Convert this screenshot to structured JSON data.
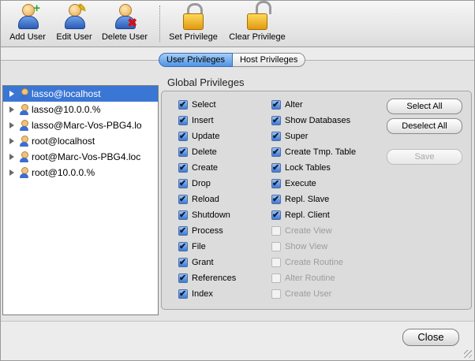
{
  "toolbar": {
    "buttons": [
      {
        "label": "Add User",
        "icon": "user-add-icon"
      },
      {
        "label": "Edit User",
        "icon": "user-edit-icon"
      },
      {
        "label": "Delete User",
        "icon": "user-delete-icon"
      },
      {
        "label": "Set Privilege",
        "icon": "lock-closed-icon"
      },
      {
        "label": "Clear Privilege",
        "icon": "lock-open-icon"
      }
    ]
  },
  "tabs": [
    {
      "label": "User Privileges",
      "active": true
    },
    {
      "label": "Host Privileges",
      "active": false
    }
  ],
  "user_list": [
    {
      "label": "lasso@localhost",
      "selected": true
    },
    {
      "label": "lasso@10.0.0.%",
      "selected": false
    },
    {
      "label": "lasso@Marc-Vos-PBG4.lo",
      "selected": false
    },
    {
      "label": "root@localhost",
      "selected": false
    },
    {
      "label": "root@Marc-Vos-PBG4.loc",
      "selected": false
    },
    {
      "label": "root@10.0.0.%",
      "selected": false
    }
  ],
  "global_privileges": {
    "title": "Global Privileges",
    "left": [
      {
        "label": "Select",
        "checked": true
      },
      {
        "label": "Insert",
        "checked": true
      },
      {
        "label": "Update",
        "checked": true
      },
      {
        "label": "Delete",
        "checked": true
      },
      {
        "label": "Create",
        "checked": true
      },
      {
        "label": "Drop",
        "checked": true
      },
      {
        "label": "Reload",
        "checked": true
      },
      {
        "label": "Shutdown",
        "checked": true
      },
      {
        "label": "Process",
        "checked": true
      },
      {
        "label": "File",
        "checked": true
      },
      {
        "label": "Grant",
        "checked": true
      },
      {
        "label": "References",
        "checked": true
      },
      {
        "label": "Index",
        "checked": true
      }
    ],
    "right": [
      {
        "label": "Alter",
        "checked": true,
        "enabled": true
      },
      {
        "label": "Show Databases",
        "checked": true,
        "enabled": true
      },
      {
        "label": "Super",
        "checked": true,
        "enabled": true
      },
      {
        "label": "Create Tmp. Table",
        "checked": true,
        "enabled": true
      },
      {
        "label": "Lock Tables",
        "checked": true,
        "enabled": true
      },
      {
        "label": "Execute",
        "checked": true,
        "enabled": true
      },
      {
        "label": "Repl. Slave",
        "checked": true,
        "enabled": true
      },
      {
        "label": "Repl. Client",
        "checked": true,
        "enabled": true
      },
      {
        "label": "Create View",
        "checked": false,
        "enabled": false
      },
      {
        "label": "Show View",
        "checked": false,
        "enabled": false
      },
      {
        "label": "Create Routine",
        "checked": false,
        "enabled": false
      },
      {
        "label": "Alter Routine",
        "checked": false,
        "enabled": false
      },
      {
        "label": "Create User",
        "checked": false,
        "enabled": false
      }
    ]
  },
  "buttons": {
    "select_all": "Select All",
    "deselect_all": "Deselect All",
    "save": "Save",
    "close": "Close"
  },
  "colors": {
    "selection": "#3a76d4",
    "tab_active": "#4f94e4",
    "checkbox": "#3e7bd2",
    "lock": "#e09a10"
  }
}
